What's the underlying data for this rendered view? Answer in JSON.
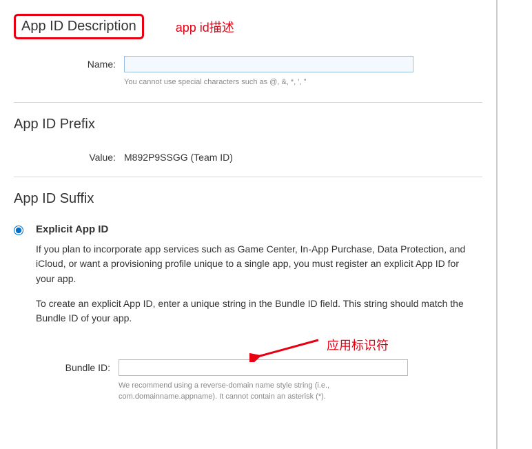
{
  "sections": {
    "description": {
      "header": "App ID Description",
      "annotation": "app id描述",
      "name_label": "Name:",
      "name_value": "",
      "name_hint": "You cannot use special characters such as @, &, *, ', \""
    },
    "prefix": {
      "header": "App ID Prefix",
      "value_label": "Value:",
      "value_text": "M892P9SSGG (Team ID)"
    },
    "suffix": {
      "header": "App ID Suffix",
      "explicit": {
        "title": "Explicit App ID",
        "desc1": "If you plan to incorporate app services such as Game Center, In-App Purchase, Data Protection, and iCloud, or want a provisioning profile unique to a single app, you must register an explicit App ID for your app.",
        "desc2": "To create an explicit App ID, enter a unique string in the Bundle ID field. This string should match the Bundle ID of your app.",
        "annotation": "应用标识符",
        "bundle_label": "Bundle ID:",
        "bundle_value": "",
        "bundle_hint": "We recommend using a reverse-domain name style string (i.e., com.domainname.appname). It cannot contain an asterisk (*)."
      }
    }
  }
}
